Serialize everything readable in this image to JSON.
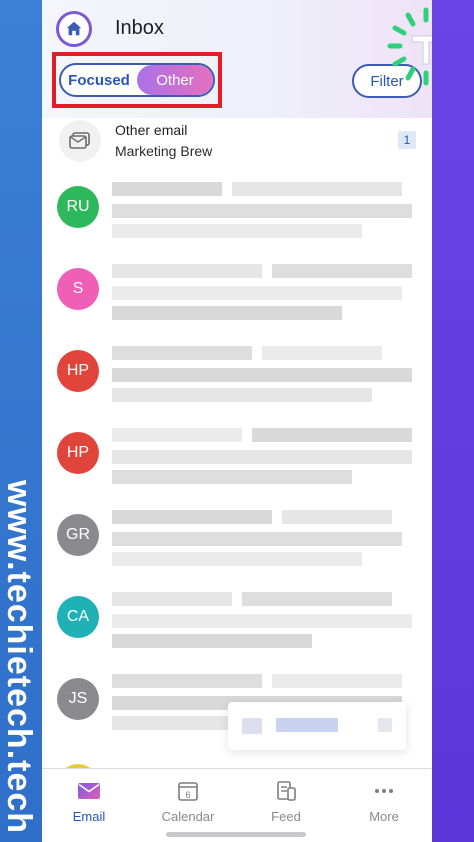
{
  "watermark": "www.techietech.tech",
  "header": {
    "title": "Inbox",
    "toggle": {
      "focused_label": "Focused",
      "other_label": "Other",
      "selected": "Other"
    },
    "filter_label": "Filter"
  },
  "other_email_row": {
    "title": "Other email",
    "subtitle": "Marketing Brew",
    "count": "1"
  },
  "messages": [
    {
      "initials": "RU",
      "color": "#2db85c"
    },
    {
      "initials": "S",
      "color": "#ee5fb5"
    },
    {
      "initials": "HP",
      "color": "#e0443a"
    },
    {
      "initials": "HP",
      "color": "#e0443a"
    },
    {
      "initials": "GR",
      "color": "#8a8a8e"
    },
    {
      "initials": "CA",
      "color": "#1fb1b5"
    },
    {
      "initials": "JS",
      "color": "#8a8a8e"
    }
  ],
  "tabs": [
    {
      "label": "Email",
      "icon": "email-icon",
      "active": true
    },
    {
      "label": "Calendar",
      "icon": "calendar-icon",
      "day": "6"
    },
    {
      "label": "Feed",
      "icon": "feed-icon"
    },
    {
      "label": "More",
      "icon": "more-icon"
    }
  ],
  "colors": {
    "accent": "#2a55b8",
    "toggle_gradient_start": "#a972e8",
    "toggle_gradient_end": "#e56fbf",
    "highlight": "#e01e2a",
    "left_strip": "#3b7fd6",
    "right_strip": "#6a44e6"
  }
}
